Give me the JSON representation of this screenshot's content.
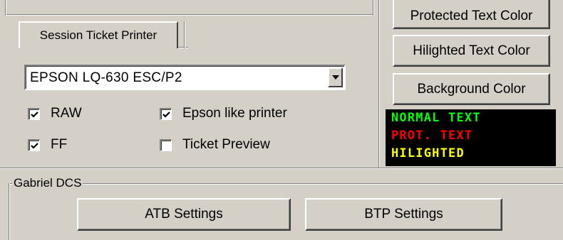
{
  "tabs": [
    {
      "label": "Session Ticket Printer",
      "active": true
    }
  ],
  "printer": {
    "selected": "EPSON LQ-630 ESC/P2"
  },
  "options": [
    {
      "label": "RAW",
      "checked": true
    },
    {
      "label": "FF",
      "checked": true
    },
    {
      "label": "Epson like printer",
      "checked": true
    },
    {
      "label": "Ticket Preview",
      "checked": false
    }
  ],
  "colors": {
    "protected_btn": "Protected Text Color",
    "hilighted_btn": "Hilighted Text Color",
    "background_btn": "Background Color",
    "preview": {
      "normal": "NORMAL TEXT",
      "protected": "PROT. TEXT",
      "hilighted": "HILIGHTED",
      "normal_color": "#00ff00",
      "protected_color": "#ff0000",
      "hilighted_color": "#ffff00",
      "background_color": "#000000"
    }
  },
  "gabriel": {
    "legend": "Gabriel DCS",
    "atb_btn": "ATB Settings",
    "btp_btn": "BTP Settings"
  }
}
